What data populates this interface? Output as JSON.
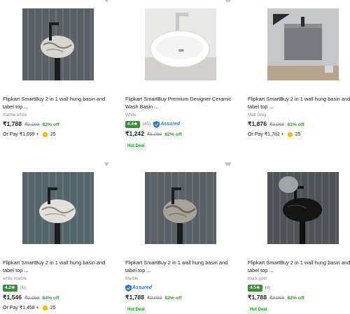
{
  "products": [
    {
      "title": "Flipkart SmartBuy 2 in 1 wall hung basin and tabel top ...",
      "variant": "marble white",
      "rating": null,
      "rating_count": null,
      "assured": false,
      "price": "₹1,788",
      "mrp": "₹9,999",
      "discount": "82% off",
      "or_pay": "Or Pay ₹1,699 +",
      "coins": "25",
      "hot_deal": null
    },
    {
      "title": "Flipkart SmartBuy Premium Designer Ceramic Wash Basin ...",
      "variant": "White",
      "rating": "4.4★",
      "rating_count": "(45)",
      "assured": true,
      "price": "₹1,242",
      "mrp": "₹6,999",
      "discount": "82% off",
      "or_pay": null,
      "coins": null,
      "hot_deal": "Hot Deal"
    },
    {
      "title": "Flipkart SmartBuy 2 in 1 wall hung basin and tabel top ...",
      "variant": "Matt Grey",
      "rating": null,
      "rating_count": null,
      "assured": false,
      "price": "₹1,876",
      "mrp": "₹9,999",
      "discount": "81% off",
      "or_pay": "Or Pay ₹1,782 +",
      "coins": "25",
      "hot_deal": null
    },
    {
      "title": "Flipkart SmartBuy 2 in 1 wall hung basin and tabel top ...",
      "variant": "white marble",
      "rating": "4.2★",
      "rating_count": "(6)",
      "assured": false,
      "price": "₹1,546",
      "mrp": "₹9,999",
      "discount": "84% off",
      "or_pay": "Or Pay ₹1,458 +",
      "coins": "25",
      "hot_deal": null
    },
    {
      "title": "Flipkart SmartBuy 2 in 1 wall hung basin and tabel top ...",
      "variant": "Marble",
      "rating": null,
      "rating_count": null,
      "assured": true,
      "price": "₹1,788",
      "mrp": "₹9,999",
      "discount": "82% off",
      "or_pay": null,
      "coins": null,
      "hot_deal": "Hot Deal"
    },
    {
      "title": "Flipkart SmartBuy 2 in 1 wall hung basin and tabel top ...",
      "variant": "black gold",
      "rating": "4.5★",
      "rating_count": "(8)",
      "assured": false,
      "price": "₹1,788",
      "mrp": "₹9,999",
      "discount": "82% off",
      "or_pay": null,
      "coins": null,
      "hot_deal": "Hot Deal"
    }
  ],
  "labels": {
    "assured": "Assured",
    "wishlist_icon": "heart-icon"
  },
  "colors": {
    "rating_green": "#388e3c",
    "assured_blue": "#2874f0",
    "hot_deal_bg": "#e6f5e8",
    "coin_gold": "#ffc200"
  }
}
